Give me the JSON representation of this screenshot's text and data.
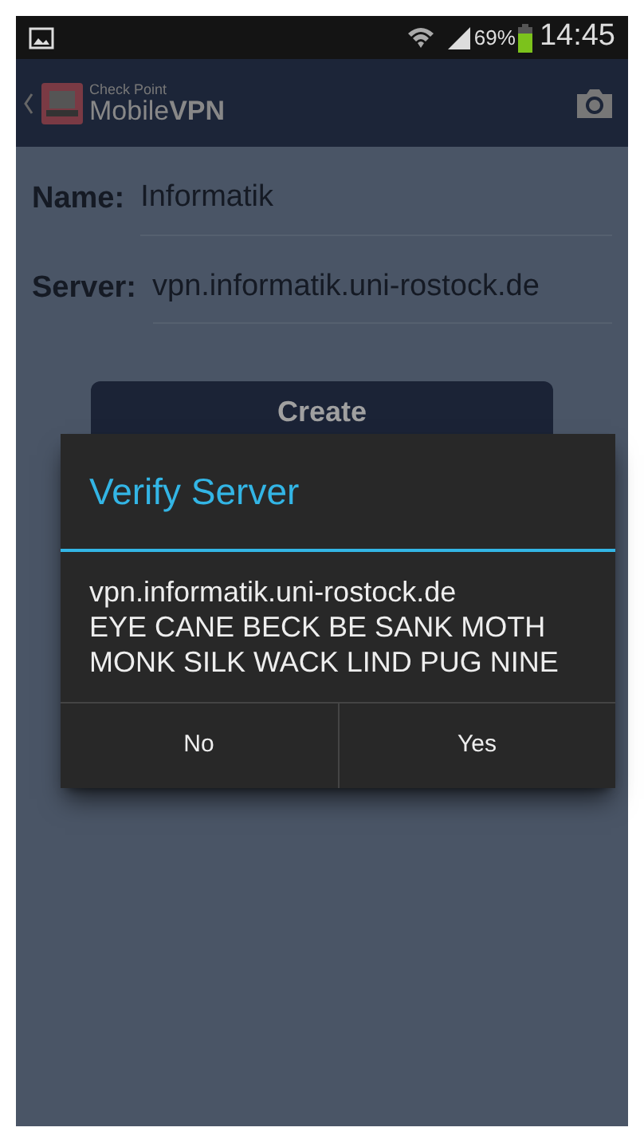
{
  "status_bar": {
    "battery": "69%",
    "time": "14:45"
  },
  "action_bar": {
    "brand_small": "Check Point",
    "brand": "Mobile**VPN**"
  },
  "form": {
    "fields": [
      {
        "label": "Name:",
        "value": "Informatik"
      },
      {
        "label": "Server:",
        "value": "vpn.informatik.uni-rostock.de"
      }
    ],
    "button": "Create"
  },
  "dialog": {
    "title": "Verify Server",
    "message_lines": [
      "vpn.informatik.uni-rostock.de",
      "EYE CANE BECK BE SANK MOTH",
      "MONK SILK WACK LIND PUG NINE"
    ],
    "buttons": [
      "No",
      "Yes"
    ]
  }
}
